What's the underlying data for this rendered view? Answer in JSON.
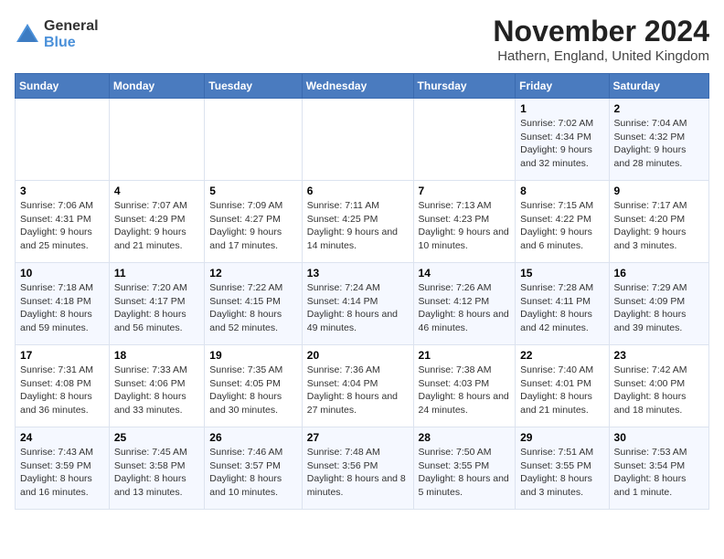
{
  "logo": {
    "general": "General",
    "blue": "Blue"
  },
  "title": "November 2024",
  "subtitle": "Hathern, England, United Kingdom",
  "days_of_week": [
    "Sunday",
    "Monday",
    "Tuesday",
    "Wednesday",
    "Thursday",
    "Friday",
    "Saturday"
  ],
  "weeks": [
    [
      {
        "day": "",
        "info": ""
      },
      {
        "day": "",
        "info": ""
      },
      {
        "day": "",
        "info": ""
      },
      {
        "day": "",
        "info": ""
      },
      {
        "day": "",
        "info": ""
      },
      {
        "day": "1",
        "info": "Sunrise: 7:02 AM\nSunset: 4:34 PM\nDaylight: 9 hours and 32 minutes."
      },
      {
        "day": "2",
        "info": "Sunrise: 7:04 AM\nSunset: 4:32 PM\nDaylight: 9 hours and 28 minutes."
      }
    ],
    [
      {
        "day": "3",
        "info": "Sunrise: 7:06 AM\nSunset: 4:31 PM\nDaylight: 9 hours and 25 minutes."
      },
      {
        "day": "4",
        "info": "Sunrise: 7:07 AM\nSunset: 4:29 PM\nDaylight: 9 hours and 21 minutes."
      },
      {
        "day": "5",
        "info": "Sunrise: 7:09 AM\nSunset: 4:27 PM\nDaylight: 9 hours and 17 minutes."
      },
      {
        "day": "6",
        "info": "Sunrise: 7:11 AM\nSunset: 4:25 PM\nDaylight: 9 hours and 14 minutes."
      },
      {
        "day": "7",
        "info": "Sunrise: 7:13 AM\nSunset: 4:23 PM\nDaylight: 9 hours and 10 minutes."
      },
      {
        "day": "8",
        "info": "Sunrise: 7:15 AM\nSunset: 4:22 PM\nDaylight: 9 hours and 6 minutes."
      },
      {
        "day": "9",
        "info": "Sunrise: 7:17 AM\nSunset: 4:20 PM\nDaylight: 9 hours and 3 minutes."
      }
    ],
    [
      {
        "day": "10",
        "info": "Sunrise: 7:18 AM\nSunset: 4:18 PM\nDaylight: 8 hours and 59 minutes."
      },
      {
        "day": "11",
        "info": "Sunrise: 7:20 AM\nSunset: 4:17 PM\nDaylight: 8 hours and 56 minutes."
      },
      {
        "day": "12",
        "info": "Sunrise: 7:22 AM\nSunset: 4:15 PM\nDaylight: 8 hours and 52 minutes."
      },
      {
        "day": "13",
        "info": "Sunrise: 7:24 AM\nSunset: 4:14 PM\nDaylight: 8 hours and 49 minutes."
      },
      {
        "day": "14",
        "info": "Sunrise: 7:26 AM\nSunset: 4:12 PM\nDaylight: 8 hours and 46 minutes."
      },
      {
        "day": "15",
        "info": "Sunrise: 7:28 AM\nSunset: 4:11 PM\nDaylight: 8 hours and 42 minutes."
      },
      {
        "day": "16",
        "info": "Sunrise: 7:29 AM\nSunset: 4:09 PM\nDaylight: 8 hours and 39 minutes."
      }
    ],
    [
      {
        "day": "17",
        "info": "Sunrise: 7:31 AM\nSunset: 4:08 PM\nDaylight: 8 hours and 36 minutes."
      },
      {
        "day": "18",
        "info": "Sunrise: 7:33 AM\nSunset: 4:06 PM\nDaylight: 8 hours and 33 minutes."
      },
      {
        "day": "19",
        "info": "Sunrise: 7:35 AM\nSunset: 4:05 PM\nDaylight: 8 hours and 30 minutes."
      },
      {
        "day": "20",
        "info": "Sunrise: 7:36 AM\nSunset: 4:04 PM\nDaylight: 8 hours and 27 minutes."
      },
      {
        "day": "21",
        "info": "Sunrise: 7:38 AM\nSunset: 4:03 PM\nDaylight: 8 hours and 24 minutes."
      },
      {
        "day": "22",
        "info": "Sunrise: 7:40 AM\nSunset: 4:01 PM\nDaylight: 8 hours and 21 minutes."
      },
      {
        "day": "23",
        "info": "Sunrise: 7:42 AM\nSunset: 4:00 PM\nDaylight: 8 hours and 18 minutes."
      }
    ],
    [
      {
        "day": "24",
        "info": "Sunrise: 7:43 AM\nSunset: 3:59 PM\nDaylight: 8 hours and 16 minutes."
      },
      {
        "day": "25",
        "info": "Sunrise: 7:45 AM\nSunset: 3:58 PM\nDaylight: 8 hours and 13 minutes."
      },
      {
        "day": "26",
        "info": "Sunrise: 7:46 AM\nSunset: 3:57 PM\nDaylight: 8 hours and 10 minutes."
      },
      {
        "day": "27",
        "info": "Sunrise: 7:48 AM\nSunset: 3:56 PM\nDaylight: 8 hours and 8 minutes."
      },
      {
        "day": "28",
        "info": "Sunrise: 7:50 AM\nSunset: 3:55 PM\nDaylight: 8 hours and 5 minutes."
      },
      {
        "day": "29",
        "info": "Sunrise: 7:51 AM\nSunset: 3:55 PM\nDaylight: 8 hours and 3 minutes."
      },
      {
        "day": "30",
        "info": "Sunrise: 7:53 AM\nSunset: 3:54 PM\nDaylight: 8 hours and 1 minute."
      }
    ]
  ]
}
